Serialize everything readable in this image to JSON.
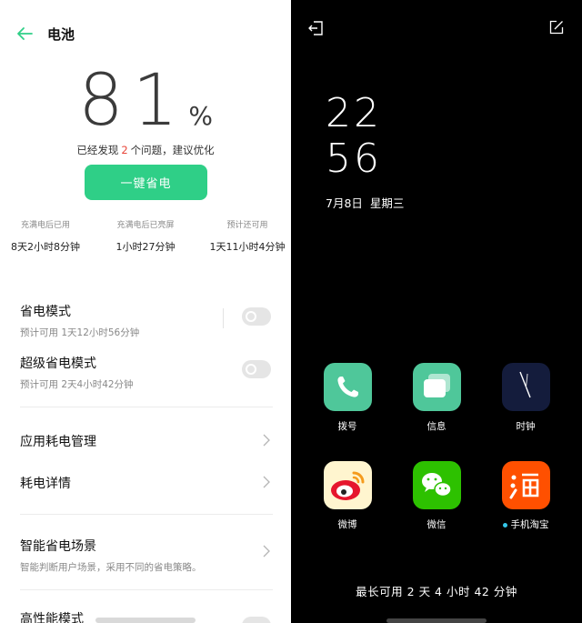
{
  "battery": {
    "title": "电池",
    "percent": "81",
    "percent_symbol": "%",
    "issues_prefix": "已经发现",
    "issues_count": "2",
    "issues_suffix": "个问题，建议优化",
    "optimize_button": "一键省电",
    "stats": [
      {
        "label": "充满电后已用",
        "value": "8天2小时8分钟"
      },
      {
        "label": "充满电后已亮屏",
        "value": "1小时27分钟"
      },
      {
        "label": "预计还可用",
        "value": "1天11小时4分钟"
      }
    ],
    "settings": [
      {
        "title": "省电模式",
        "subtitle": "预计可用 1天12小时56分钟"
      },
      {
        "title": "超级省电模式",
        "subtitle": "预计可用 2天4小时42分钟"
      },
      {
        "title": "应用耗电管理"
      },
      {
        "title": "耗电详情"
      },
      {
        "title": "智能省电场景",
        "subtitle": "智能判断用户场景，采用不同的省电策略。"
      },
      {
        "title": "高性能模式"
      }
    ],
    "accent_color": "#2fcf87",
    "issue_color": "#e8463a"
  },
  "launcher": {
    "clock_hour": "22",
    "clock_minute": "56",
    "date": "7月8日",
    "weekday": "星期三",
    "apps": [
      {
        "name": "拨号",
        "icon": "phone-icon"
      },
      {
        "name": "信息",
        "icon": "messages-icon"
      },
      {
        "name": "时钟",
        "icon": "clock-icon"
      },
      {
        "name": "微博",
        "icon": "weibo-icon"
      },
      {
        "name": "微信",
        "icon": "wechat-icon"
      },
      {
        "name": "手机淘宝",
        "icon": "taobao-icon"
      }
    ],
    "battery_remaining": "最长可用 2 天 4 小时 42 分钟"
  }
}
